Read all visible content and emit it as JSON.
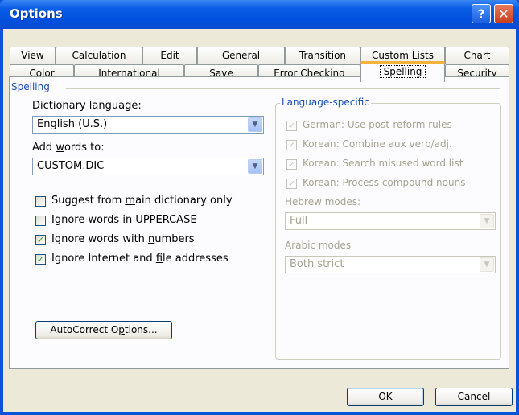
{
  "window": {
    "title": "Options"
  },
  "titlebar": {
    "help_glyph": "?",
    "close_glyph": "✕"
  },
  "tabs_row1": [
    "View",
    "Calculation",
    "Edit",
    "General",
    "Transition",
    "Custom Lists",
    "Chart"
  ],
  "tabs_row2": [
    "Color",
    "International",
    "Save",
    "Error Checking",
    "Spelling",
    "Security"
  ],
  "spelling": {
    "section": "Spelling",
    "dictionary_label": "Dictionary language:",
    "dictionary_value": "English (U.S.)",
    "addwords_label_pre": "Add ",
    "addwords_label_u": "w",
    "addwords_label_post": "ords to:",
    "addwords_value": "CUSTOM.DIC",
    "suggest_pre": "Suggest from ",
    "suggest_u": "m",
    "suggest_post": "ain dictionary only",
    "suggest_checked": false,
    "upper_pre": "Ignore words in ",
    "upper_u": "U",
    "upper_post": "PPERCASE",
    "upper_checked": false,
    "numbers_pre": "Ignore words with ",
    "numbers_u": "n",
    "numbers_post": "umbers",
    "numbers_checked": true,
    "internet_pre": "Ignore Internet and ",
    "internet_u": "f",
    "internet_post": "ile addresses",
    "internet_checked": true,
    "autocorrect_pre": "AutoCorrect O",
    "autocorrect_u": "p",
    "autocorrect_post": "tions..."
  },
  "language_specific": {
    "title": "Language-specific",
    "german": "German: Use post-reform rules",
    "korean_combine": "Korean: Combine aux verb/adj.",
    "korean_search": "Korean: Search misused word list",
    "korean_compound": "Korean: Process compound nouns",
    "hebrew_label": "Hebrew modes:",
    "hebrew_value": "Full",
    "arabic_label": "Arabic modes",
    "arabic_value": "Both strict"
  },
  "buttons": {
    "ok": "OK",
    "cancel": "Cancel"
  },
  "glyphs": {
    "check": "✓",
    "dropdown": "▼"
  },
  "colors": {
    "titlebar": "#0b5ce6",
    "dialog_bg": "#ece9d8",
    "active_tab_accent": "#f6b33b",
    "section_title": "#1a4fb5"
  }
}
